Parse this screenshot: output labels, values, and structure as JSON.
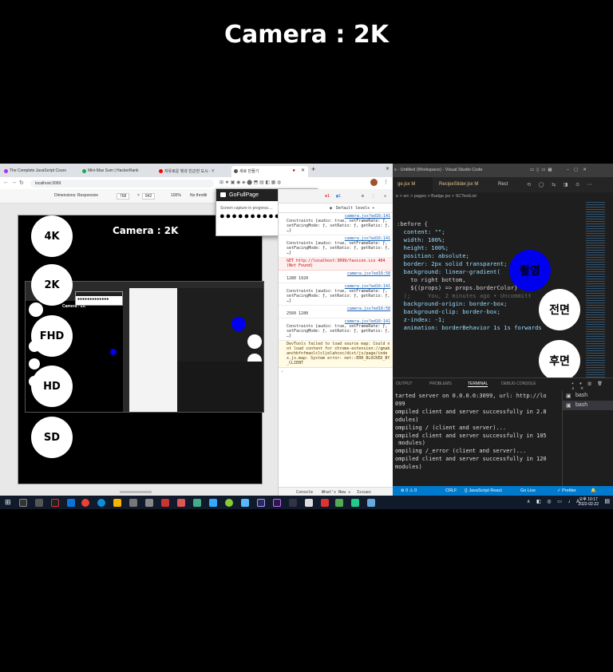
{
  "header": {
    "title": "Camera : 2K"
  },
  "chrome": {
    "tabs": [
      {
        "label": "The Complete JavaScript Cours",
        "color": "#a435f0"
      },
      {
        "label": "Mini-Max Sum | HackerRank",
        "color": "#1ba94c"
      },
      {
        "label": "자유로운 빛과 빈곤한 도시 - Y",
        "color": "#ff0000"
      },
      {
        "label": "새로 만들기",
        "color": "#555555"
      }
    ],
    "url": "localhost:3099",
    "devbar": {
      "dimensions_label": "Dimensions: Responsive",
      "width": "768",
      "height": "842",
      "zoom": "100%",
      "throttle": "No throttli"
    }
  },
  "emulated": {
    "title": "Camera : 2K",
    "buttons": [
      {
        "label": "4K"
      },
      {
        "label": "2K"
      },
      {
        "label": "FHD"
      },
      {
        "label": "HD"
      },
      {
        "label": "SD"
      }
    ]
  },
  "popup": {
    "title": "GoFullPage",
    "message": "Screen capture in progress....",
    "dots": "●●●●●●●●●●●●●"
  },
  "console": {
    "default_levels": "Default levels ▾",
    "entries": [
      {
        "src": "camera.jsx?ed16:141",
        "text": "Constraints {audio: true, setFrameRate: ƒ, setFacingMode: ƒ, setRatio: ƒ, getRatio: ƒ, …}",
        "kind": "log"
      },
      {
        "src": "camera.jsx?ed16:141",
        "text": "Constraints {audio: true, setFrameRate: ƒ, setFacingMode: ƒ, setRatio: ƒ, getRatio: ƒ, …}",
        "kind": "log"
      },
      {
        "src": "",
        "text": "GET http://localhost:3099/favicon.ico 404 (Not Found)",
        "kind": "err"
      },
      {
        "src": "camera.jsx?ed16:58",
        "text": "1280 1920",
        "kind": "log"
      },
      {
        "src": "camera.jsx?ed16:141",
        "text": "Constraints {audio: true, setFrameRate: ƒ, setFacingMode: ƒ, setRatio: ƒ, getRatio: ƒ, …}",
        "kind": "log"
      },
      {
        "src": "camera.jsx?ed16:58",
        "text": "2560 1280",
        "kind": "log"
      },
      {
        "src": "camera.jsx?ed16:141",
        "text": "Constraints {audio: true, setFrameRate: ƒ, setFacingMode: ƒ, setRatio: ƒ, getRatio: ƒ, …}",
        "kind": "log"
      },
      {
        "src": "",
        "text": "DevTools failed to load source map: Could not load content for chrome-extension://gmabanchbfnfmaolclcljelahcoc/dist/js/page/index.js.map: System error: net::ERR_BLOCKED_BY_CLIENT",
        "kind": "warn"
      }
    ],
    "bottom_tabs": [
      "Console",
      "What's New ✕",
      "Issues"
    ]
  },
  "vscode": {
    "title": "x - Untitled (Workspace) - Visual Studio Code",
    "tabs": [
      {
        "label": "ge.jsx M",
        "modified": true,
        "active": true
      },
      {
        "label": "RecipeSlider.jsx M",
        "modified": true,
        "active": false
      },
      {
        "label": "Rect",
        "modified": false,
        "active": false
      }
    ],
    "breadcrumb": "e > src > pages > Badge.jsx > SCTextList",
    "code_lines": [
      ":before {",
      "  content: \"\";",
      "  width: 100%;",
      "  height: 100%;",
      "  position: absolute;",
      "",
      "  border: 2px solid transparent;",
      "  background: linear-gradient(",
      "    to right bottom,",
      "    ${(props) => props.borderColor}",
      "  );     You, 2 minutes ago • Uncommitt",
      "  background-origin: border-box;",
      "  background-clip: border-box;",
      "  z-index: -1;",
      "",
      "  animation: borderBehavior 1s 1s forwards"
    ],
    "overlay_buttons": {
      "start": "촬영",
      "front": "전면",
      "back": "후면"
    },
    "panel_tabs": [
      "OUTPUT",
      "PROBLEMS",
      "TERMINAL",
      "DEBUG CONSOLE"
    ],
    "terminal_lines": [
      "tarted server on 0.0.0.0:3099, url: http://lo",
      "099",
      "ompiled client and server successfully in 2.8",
      "odules)",
      "ompiling / (client and server)...",
      "ompiled client and server successfully in 105",
      " modules)",
      "ompiling /_error (client and server)...",
      "ompiled client and server successfully in 120",
      "modules)"
    ],
    "terminal_list": [
      "bash",
      "bash"
    ],
    "status": {
      "problems": "⊗ 0  ⚠ 0",
      "crlf": "CRLF",
      "language": "{} JavaScript React",
      "golive": "Go Live",
      "prettier": "✓ Prettier"
    }
  },
  "taskbar": {
    "time": "오후 10:17",
    "date": "2022-02-22"
  },
  "colors": {
    "start_button": "#0000ee",
    "vscode_status": "#007acc"
  }
}
